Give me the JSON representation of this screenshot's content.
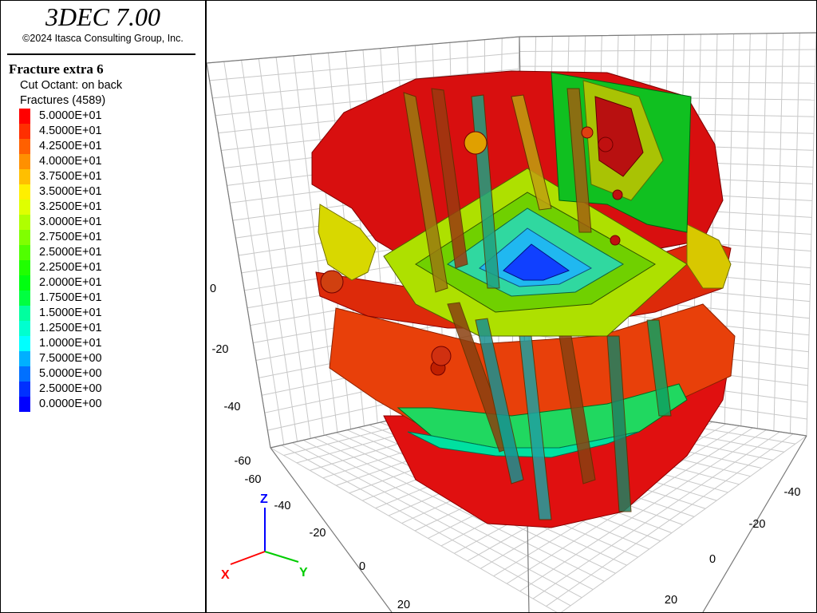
{
  "app": {
    "title": "3DEC 7.00",
    "copyright": "©2024 Itasca Consulting Group, Inc."
  },
  "plot": {
    "title": "Fracture extra 6",
    "cut_octant": "Cut Octant: on back",
    "fractures_label": "Fractures (4589)"
  },
  "legend": [
    {
      "label": "5.0000E+01",
      "color": "#ff0000"
    },
    {
      "label": "4.5000E+01",
      "color": "#ff2f00"
    },
    {
      "label": "4.2500E+01",
      "color": "#ff6000"
    },
    {
      "label": "4.0000E+01",
      "color": "#ff9000"
    },
    {
      "label": "3.7500E+01",
      "color": "#ffbf00"
    },
    {
      "label": "3.5000E+01",
      "color": "#ffef00"
    },
    {
      "label": "3.2500E+01",
      "color": "#dfff00"
    },
    {
      "label": "3.0000E+01",
      "color": "#afff00"
    },
    {
      "label": "2.7500E+01",
      "color": "#80ff00"
    },
    {
      "label": "2.5000E+01",
      "color": "#50ff00"
    },
    {
      "label": "2.2500E+01",
      "color": "#20ff00"
    },
    {
      "label": "2.0000E+01",
      "color": "#00ff10"
    },
    {
      "label": "1.7500E+01",
      "color": "#00ff40"
    },
    {
      "label": "1.5000E+01",
      "color": "#00ff9f"
    },
    {
      "label": "1.2500E+01",
      "color": "#00ffcf"
    },
    {
      "label": "1.0000E+01",
      "color": "#00ffff"
    },
    {
      "label": "7.5000E+00",
      "color": "#00b0ff"
    },
    {
      "label": "5.0000E+00",
      "color": "#0070ff"
    },
    {
      "label": "2.5000E+00",
      "color": "#0030ff"
    },
    {
      "label": "0.0000E+00",
      "color": "#0000ff"
    }
  ],
  "axes": {
    "z_ticks": [
      "0",
      "-20",
      "-40",
      "-60"
    ],
    "x_ticks": [
      "-60",
      "-40",
      "-20",
      "0",
      "20"
    ],
    "y_ticks": [
      "-40",
      "-20",
      "0",
      "20"
    ],
    "triad": {
      "z": "Z",
      "x": "X",
      "y": "Y",
      "z_color": "#0000ff",
      "x_color": "#ff0000",
      "y_color": "#00cc00"
    }
  }
}
